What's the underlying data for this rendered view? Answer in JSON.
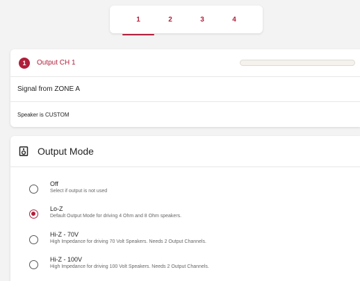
{
  "tabs": [
    "1",
    "2",
    "3",
    "4"
  ],
  "active_tab": "1",
  "channel": {
    "number": "1",
    "title": "Output CH 1",
    "signal": "Signal from ZONE A",
    "speaker": "Speaker is CUSTOM"
  },
  "output_mode": {
    "title": "Output Mode",
    "icon": "speaker-icon",
    "selected": "Lo-Z",
    "options": [
      {
        "label": "Off",
        "description": "Select if output is not used"
      },
      {
        "label": "Lo-Z",
        "description": "Default Output Mode for driving 4 Ohm and 8 Ohm speakers."
      },
      {
        "label": "Hi-Z - 70V",
        "description": "High Impedance for driving 70 Volt Speakers. Needs 2 Output Channels."
      },
      {
        "label": "Hi-Z - 100V",
        "description": "High Impedance for driving 100 Volt Speakers. Needs 2 Output Channels."
      }
    ]
  },
  "colors": {
    "accent": "#b01e3a",
    "background": "#f3f3f3"
  }
}
